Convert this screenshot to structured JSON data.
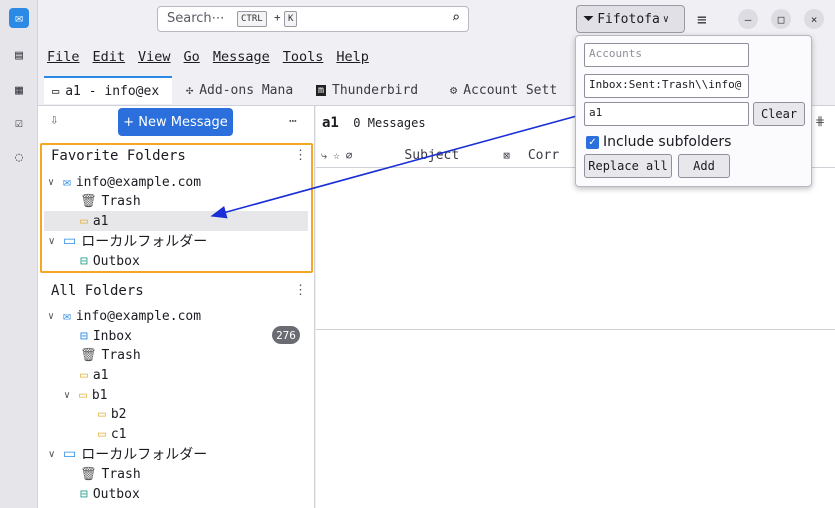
{
  "search": {
    "placeholder": "Search⋯",
    "key1": "CTRL",
    "plus": "+",
    "key2": "K"
  },
  "filter_button": {
    "label": "Fifotofa"
  },
  "menu": [
    "File",
    "Edit",
    "View",
    "Go",
    "Message",
    "Tools",
    "Help"
  ],
  "tabs": [
    {
      "label": "a1 - info@ex"
    },
    {
      "label": "Add-ons Mana"
    },
    {
      "label": "Thunderbird"
    },
    {
      "label": "Account Sett"
    }
  ],
  "toolbar": {
    "new_message": "+ New Message",
    "more": "⋯"
  },
  "favorite_folders": {
    "title": "Favorite Folders",
    "account": "info@example.com",
    "trash": "Trash",
    "a1": "a1",
    "local": "ローカルフォルダー",
    "outbox": "Outbox"
  },
  "all_folders": {
    "title": "All Folders",
    "account": "info@example.com",
    "inbox": "Inbox",
    "inbox_count": "276",
    "trash": "Trash",
    "a1": "a1",
    "b1": "b1",
    "b2": "b2",
    "c1": "c1",
    "local": "ローカルフォルダー",
    "local_trash": "Trash",
    "local_outbox": "Outbox"
  },
  "message_list": {
    "folder": "a1",
    "count_label": "0 Messages",
    "col_subject": "Subject",
    "col_corr": "Corr"
  },
  "popup": {
    "accounts_placeholder": "Accounts",
    "folders_value": "Inbox:Sent:Trash\\\\info@",
    "filter_value": "a1",
    "clear": "Clear",
    "include_subfolders": "Include subfolders",
    "replace_all": "Replace all",
    "add": "Add"
  },
  "colors": {
    "accent": "#2a6fdb",
    "highlight_border": "#f5a623",
    "arrow": "#1a2fd6"
  }
}
